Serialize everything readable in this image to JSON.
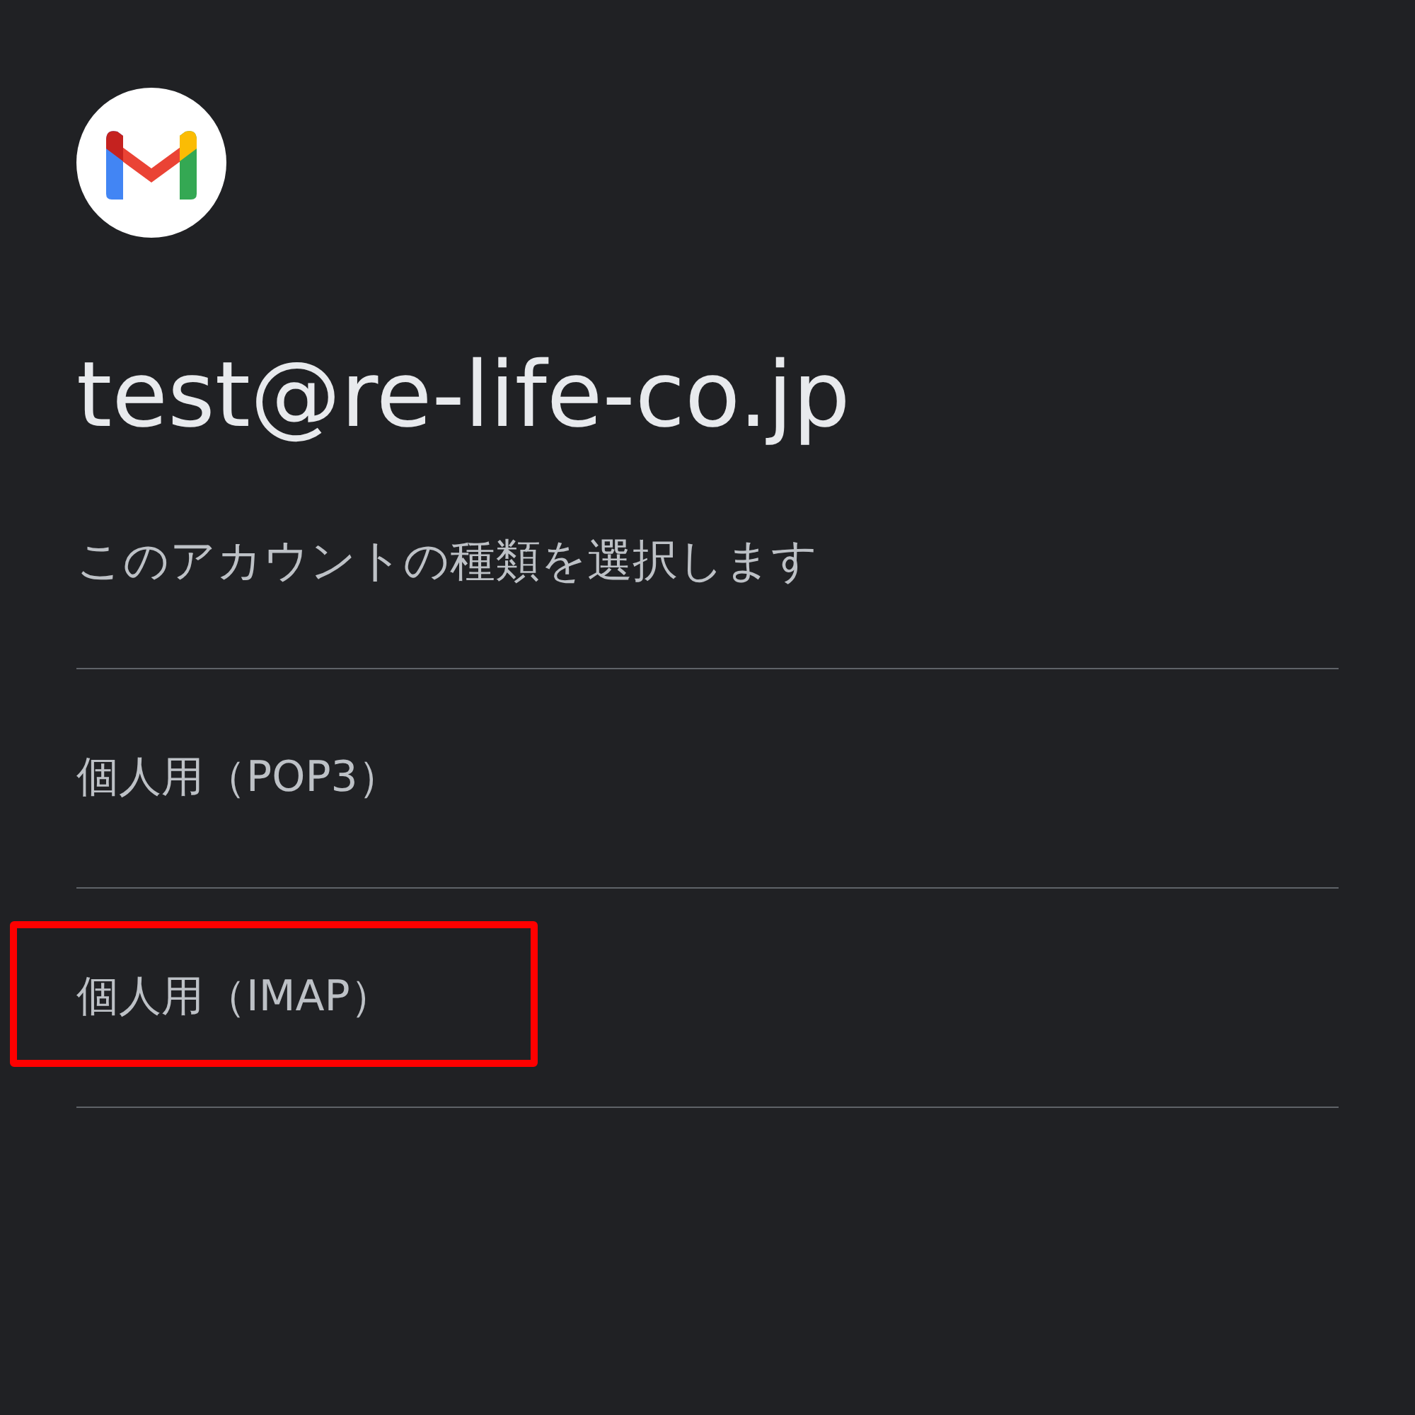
{
  "account": {
    "email": "test@re-life-co.jp"
  },
  "prompt": "このアカウントの種類を選択します",
  "options": [
    {
      "label": "個人用（POP3）",
      "highlighted": false
    },
    {
      "label": "個人用（IMAP）",
      "highlighted": true
    }
  ]
}
